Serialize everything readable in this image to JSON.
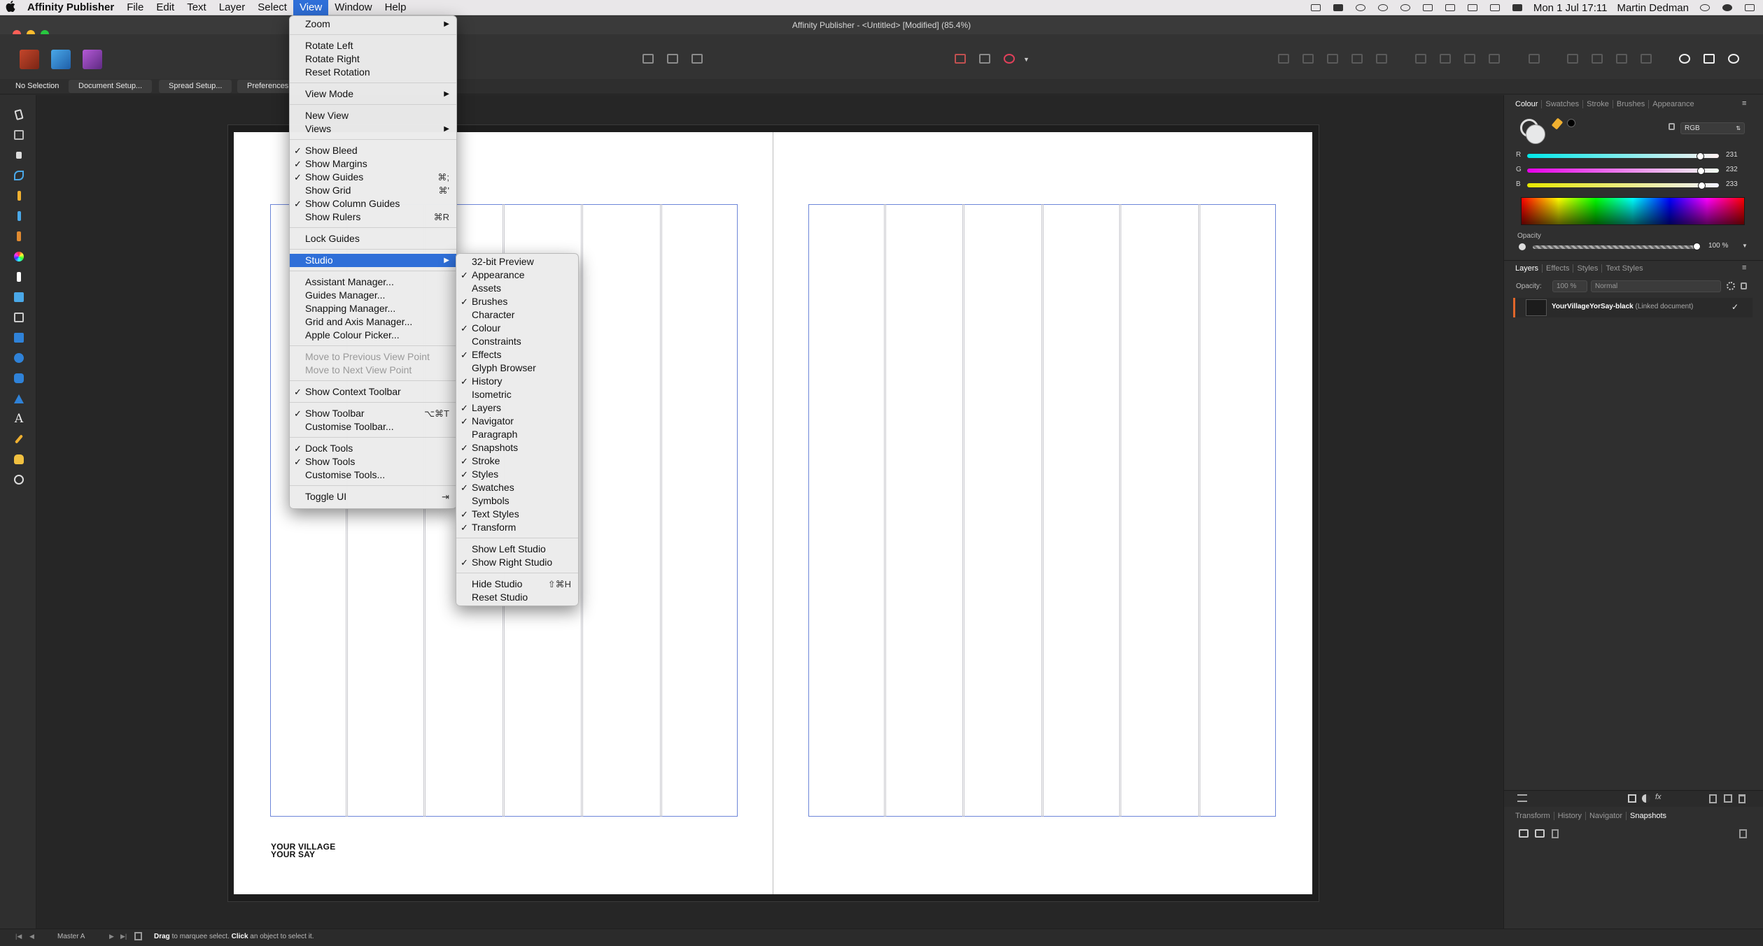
{
  "menubar": {
    "apple": "",
    "app_name": "Affinity Publisher",
    "menus": [
      "File",
      "Edit",
      "Text",
      "Layer",
      "Select",
      "View",
      "Window",
      "Help"
    ],
    "active_menu": "View",
    "clock": "Mon 1 Jul  17:11",
    "user": "Martin Dedman"
  },
  "window": {
    "title": "Affinity Publisher - <Untitled> [Modified] (85.4%)"
  },
  "context_toolbar": {
    "selection_label": "No Selection",
    "buttons": [
      "Document Setup...",
      "Spread Setup...",
      "Preferences..."
    ]
  },
  "canvas": {
    "brand_line1": "YOUR VILLAGE",
    "brand_line2": "YOUR SAY"
  },
  "view_menu": {
    "items": [
      {
        "label": "Zoom",
        "submenu": true
      },
      {
        "sep": true
      },
      {
        "label": "Rotate Left"
      },
      {
        "label": "Rotate Right"
      },
      {
        "label": "Reset Rotation"
      },
      {
        "sep": true
      },
      {
        "label": "View Mode",
        "submenu": true
      },
      {
        "sep": true
      },
      {
        "label": "New View"
      },
      {
        "label": "Views",
        "submenu": true
      },
      {
        "sep": true
      },
      {
        "label": "Show Bleed",
        "checked": true
      },
      {
        "label": "Show Margins",
        "checked": true
      },
      {
        "label": "Show Guides",
        "checked": true,
        "shortcut": "⌘;"
      },
      {
        "label": "Show Grid",
        "shortcut": "⌘'"
      },
      {
        "label": "Show Column Guides",
        "checked": true
      },
      {
        "label": "Show Rulers",
        "shortcut": "⌘R"
      },
      {
        "sep": true
      },
      {
        "label": "Lock Guides"
      },
      {
        "sep": true
      },
      {
        "label": "Studio",
        "submenu": true,
        "selected": true
      },
      {
        "sep": true
      },
      {
        "label": "Assistant Manager..."
      },
      {
        "label": "Guides Manager..."
      },
      {
        "label": "Snapping Manager..."
      },
      {
        "label": "Grid and Axis Manager..."
      },
      {
        "label": "Apple Colour Picker..."
      },
      {
        "sep": true
      },
      {
        "label": "Move to Previous View Point",
        "disabled": true
      },
      {
        "label": "Move to Next View Point",
        "disabled": true
      },
      {
        "sep": true
      },
      {
        "label": "Show Context Toolbar",
        "checked": true
      },
      {
        "sep": true
      },
      {
        "label": "Show Toolbar",
        "checked": true,
        "shortcut": "⌥⌘T"
      },
      {
        "label": "Customise Toolbar..."
      },
      {
        "sep": true
      },
      {
        "label": "Dock Tools",
        "checked": true
      },
      {
        "label": "Show Tools",
        "checked": true
      },
      {
        "label": "Customise Tools..."
      },
      {
        "sep": true
      },
      {
        "label": "Toggle UI",
        "shortcut": "⇥"
      }
    ]
  },
  "studio_menu": {
    "items": [
      {
        "label": "32-bit Preview"
      },
      {
        "label": "Appearance",
        "checked": true
      },
      {
        "label": "Assets"
      },
      {
        "label": "Brushes",
        "checked": true
      },
      {
        "label": "Character"
      },
      {
        "label": "Colour",
        "checked": true
      },
      {
        "label": "Constraints"
      },
      {
        "label": "Effects",
        "checked": true
      },
      {
        "label": "Glyph Browser"
      },
      {
        "label": "History",
        "checked": true
      },
      {
        "label": "Isometric"
      },
      {
        "label": "Layers",
        "checked": true
      },
      {
        "label": "Navigator",
        "checked": true
      },
      {
        "label": "Paragraph"
      },
      {
        "label": "Snapshots",
        "checked": true
      },
      {
        "label": "Stroke",
        "checked": true
      },
      {
        "label": "Styles",
        "checked": true
      },
      {
        "label": "Swatches",
        "checked": true
      },
      {
        "label": "Symbols"
      },
      {
        "label": "Text Styles",
        "checked": true
      },
      {
        "label": "Transform",
        "checked": true
      },
      {
        "sep": true
      },
      {
        "label": "Show Left Studio"
      },
      {
        "label": "Show Right Studio",
        "checked": true
      },
      {
        "sep": true
      },
      {
        "label": "Hide Studio",
        "shortcut": "⇧⌘H"
      },
      {
        "label": "Reset Studio"
      }
    ]
  },
  "colour_panel": {
    "tabs": [
      "Colour",
      "Swatches",
      "Stroke",
      "Brushes",
      "Appearance"
    ],
    "active_tab": "Colour",
    "model": "RGB",
    "r_label": "R",
    "r": "231",
    "g_label": "G",
    "g": "232",
    "b_label": "B",
    "b": "233",
    "r_fraction": 0.906,
    "g_fraction": 0.91,
    "b_fraction": 0.914,
    "opacity_label": "Opacity",
    "opacity": "100 %"
  },
  "layers_panel": {
    "tabs": [
      "Layers",
      "Effects",
      "Styles",
      "Text Styles"
    ],
    "active_tab": "Layers",
    "opacity_label": "Opacity:",
    "opacity_value": "100 %",
    "blend_mode": "Normal",
    "layer_name": "YourVillageYorSay-black",
    "layer_kind": "(Linked document)",
    "layer_check": "✓"
  },
  "bottom_panel": {
    "tabs": [
      "Transform",
      "History",
      "Navigator",
      "Snapshots"
    ],
    "active_tab": "Snapshots"
  },
  "statusbar": {
    "page": "Master A",
    "hint_bold1": "Drag",
    "hint_text1": " to marquee select. ",
    "hint_bold2": "Click",
    "hint_text2": " an object to select it."
  },
  "colors": {
    "accent": "#2f6fd8",
    "margin_guide": "#6d86d8",
    "layer_marker": "#e0662a"
  }
}
